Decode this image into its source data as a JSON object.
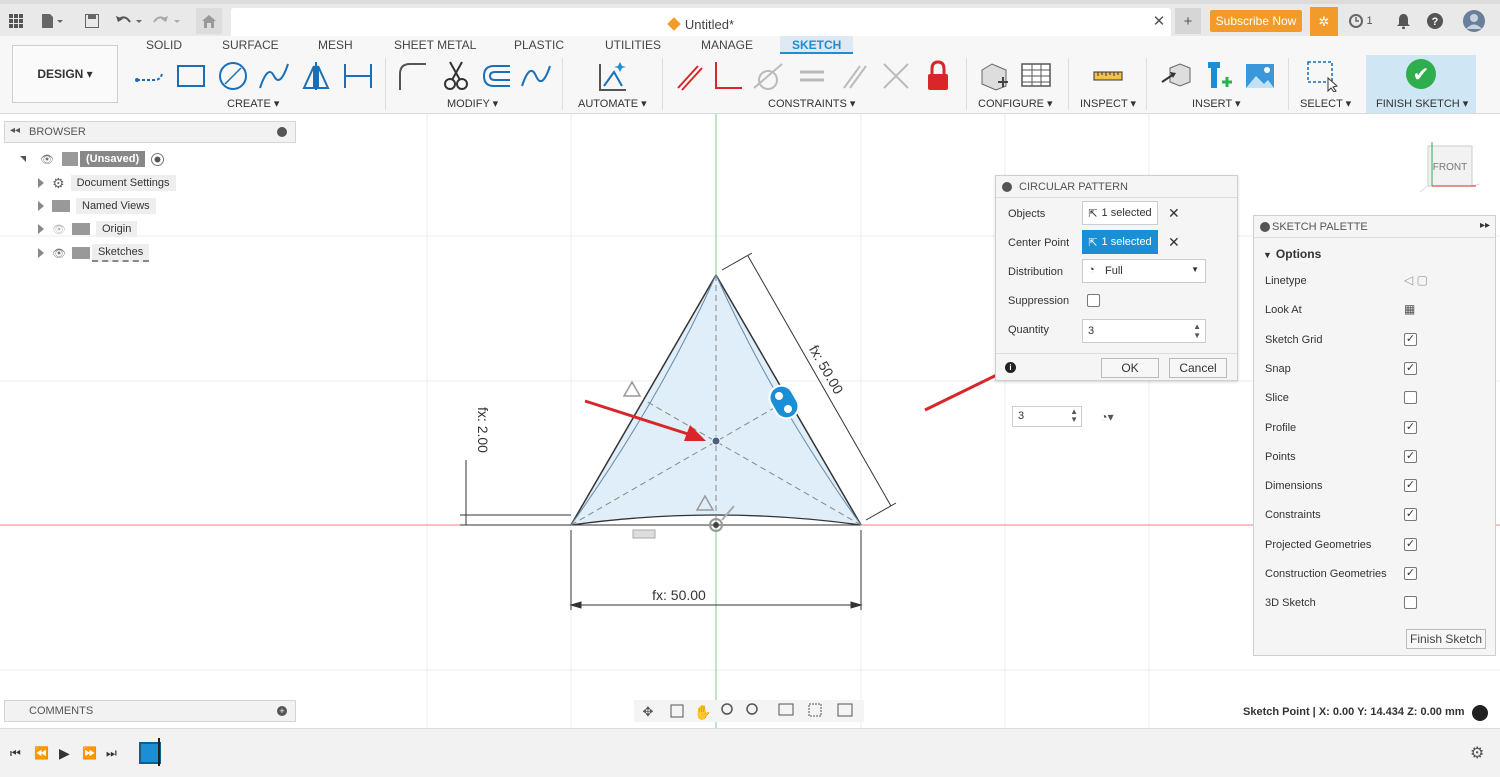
{
  "title_bar": {
    "doc_title": "Untitled*",
    "subscribe_label": "Subscribe Now",
    "jobs_count": "1"
  },
  "ribbon": {
    "design_label": "DESIGN ▾",
    "tabs": [
      "SOLID",
      "SURFACE",
      "MESH",
      "SHEET METAL",
      "PLASTIC",
      "UTILITIES",
      "MANAGE",
      "SKETCH"
    ],
    "groups": [
      "CREATE ▾",
      "MODIFY ▾",
      "AUTOMATE ▾",
      "CONSTRAINTS ▾",
      "CONFIGURE ▾",
      "INSPECT ▾",
      "INSERT ▾",
      "SELECT ▾",
      "FINISH SKETCH ▾"
    ]
  },
  "browser": {
    "title": "BROWSER",
    "items": [
      "(Unsaved)",
      "Document Settings",
      "Named Views",
      "Origin",
      "Sketches"
    ]
  },
  "comments_title": "COMMENTS",
  "canvas": {
    "dim_bottom": "fx: 50.00",
    "dim_side": "fx: 50.00",
    "dim_height": "fx: 2.00",
    "viewcube_label": "FRONT",
    "inline_quantity": "3"
  },
  "circular_pattern": {
    "title": "CIRCULAR PATTERN",
    "objects_label": "Objects",
    "objects_value": "1 selected",
    "center_label": "Center Point",
    "center_value": "1 selected",
    "distribution_label": "Distribution",
    "distribution_value": "Full",
    "suppression_label": "Suppression",
    "quantity_label": "Quantity",
    "quantity_value": "3",
    "ok_label": "OK",
    "cancel_label": "Cancel"
  },
  "sketch_palette": {
    "title": "SKETCH PALETTE",
    "section": "Options",
    "rows": [
      {
        "label": "Linetype",
        "checked": null
      },
      {
        "label": "Look At",
        "checked": null
      },
      {
        "label": "Sketch Grid",
        "checked": true
      },
      {
        "label": "Snap",
        "checked": true
      },
      {
        "label": "Slice",
        "checked": false
      },
      {
        "label": "Profile",
        "checked": true
      },
      {
        "label": "Points",
        "checked": true
      },
      {
        "label": "Dimensions",
        "checked": true
      },
      {
        "label": "Constraints",
        "checked": true
      },
      {
        "label": "Projected Geometries",
        "checked": true
      },
      {
        "label": "Construction Geometries",
        "checked": true
      },
      {
        "label": "3D Sketch",
        "checked": false
      }
    ],
    "finish_label": "Finish Sketch"
  },
  "status": {
    "text": "Sketch Point | X: 0.00 Y: 14.434 Z: 0.00 mm"
  },
  "colors": {
    "accent": "#1a8fd6",
    "subscribe": "#f39b2a",
    "finish_check": "#2fae4e",
    "arrow_red": "#d9262a",
    "fill_blue": "#dfeef8"
  }
}
